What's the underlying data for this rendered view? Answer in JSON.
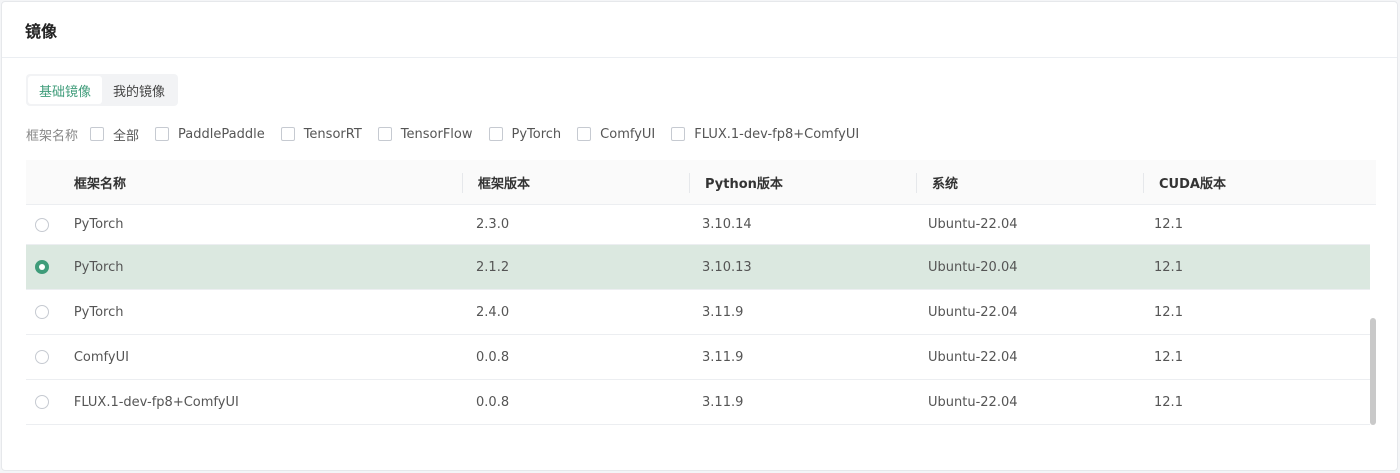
{
  "header": {
    "title": "镜像"
  },
  "tabs": [
    {
      "label": "基础镜像",
      "active": true
    },
    {
      "label": "我的镜像",
      "active": false
    }
  ],
  "filters": {
    "label": "框架名称",
    "options": [
      "全部",
      "PaddlePaddle",
      "TensorRT",
      "TensorFlow",
      "PyTorch",
      "ComfyUI",
      "FLUX.1-dev-fp8+ComfyUI"
    ]
  },
  "table": {
    "columns": [
      "框架名称",
      "框架版本",
      "Python版本",
      "系统",
      "CUDA版本"
    ],
    "rows": [
      {
        "name": "PyTorch",
        "version": "2.3.0",
        "python": "3.10.14",
        "os": "Ubuntu-22.04",
        "cuda": "12.1",
        "selected": false
      },
      {
        "name": "PyTorch",
        "version": "2.1.2",
        "python": "3.10.13",
        "os": "Ubuntu-20.04",
        "cuda": "12.1",
        "selected": true
      },
      {
        "name": "PyTorch",
        "version": "2.4.0",
        "python": "3.11.9",
        "os": "Ubuntu-22.04",
        "cuda": "12.1",
        "selected": false
      },
      {
        "name": "ComfyUI",
        "version": "0.0.8",
        "python": "3.11.9",
        "os": "Ubuntu-22.04",
        "cuda": "12.1",
        "selected": false
      },
      {
        "name": "FLUX.1-dev-fp8+ComfyUI",
        "version": "0.0.8",
        "python": "3.11.9",
        "os": "Ubuntu-22.04",
        "cuda": "12.1",
        "selected": false
      }
    ]
  },
  "colors": {
    "accent": "#3f9c7a",
    "selected_row": "#dbe8e0"
  }
}
